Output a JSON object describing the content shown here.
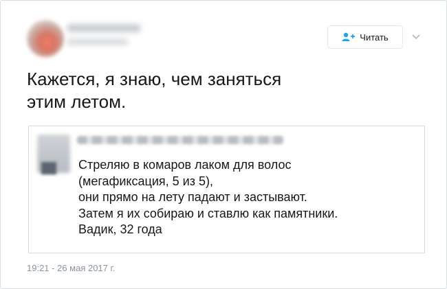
{
  "header": {
    "follow_button_label": "Читать"
  },
  "tweet": {
    "text_lines": [
      "Кажется, я знаю, чем заняться",
      "этим летом."
    ],
    "timestamp": "19:21 - 26 мая 2017 г."
  },
  "quote": {
    "text_lines": [
      "Стреляю в комаров лаком для волос",
      "(мегафиксация, 5 из 5),",
      "они прямо на лету падают и застывают.",
      "Затем я их собираю и ставлю как памятники.",
      "Вадик, 32 года"
    ]
  },
  "icons": {
    "follow": "add-user-icon",
    "menu": "chevron-down-icon"
  },
  "colors": {
    "accent": "#1da1f2",
    "text": "#14171a",
    "muted": "#8a949e",
    "border": "#d8dde1"
  }
}
